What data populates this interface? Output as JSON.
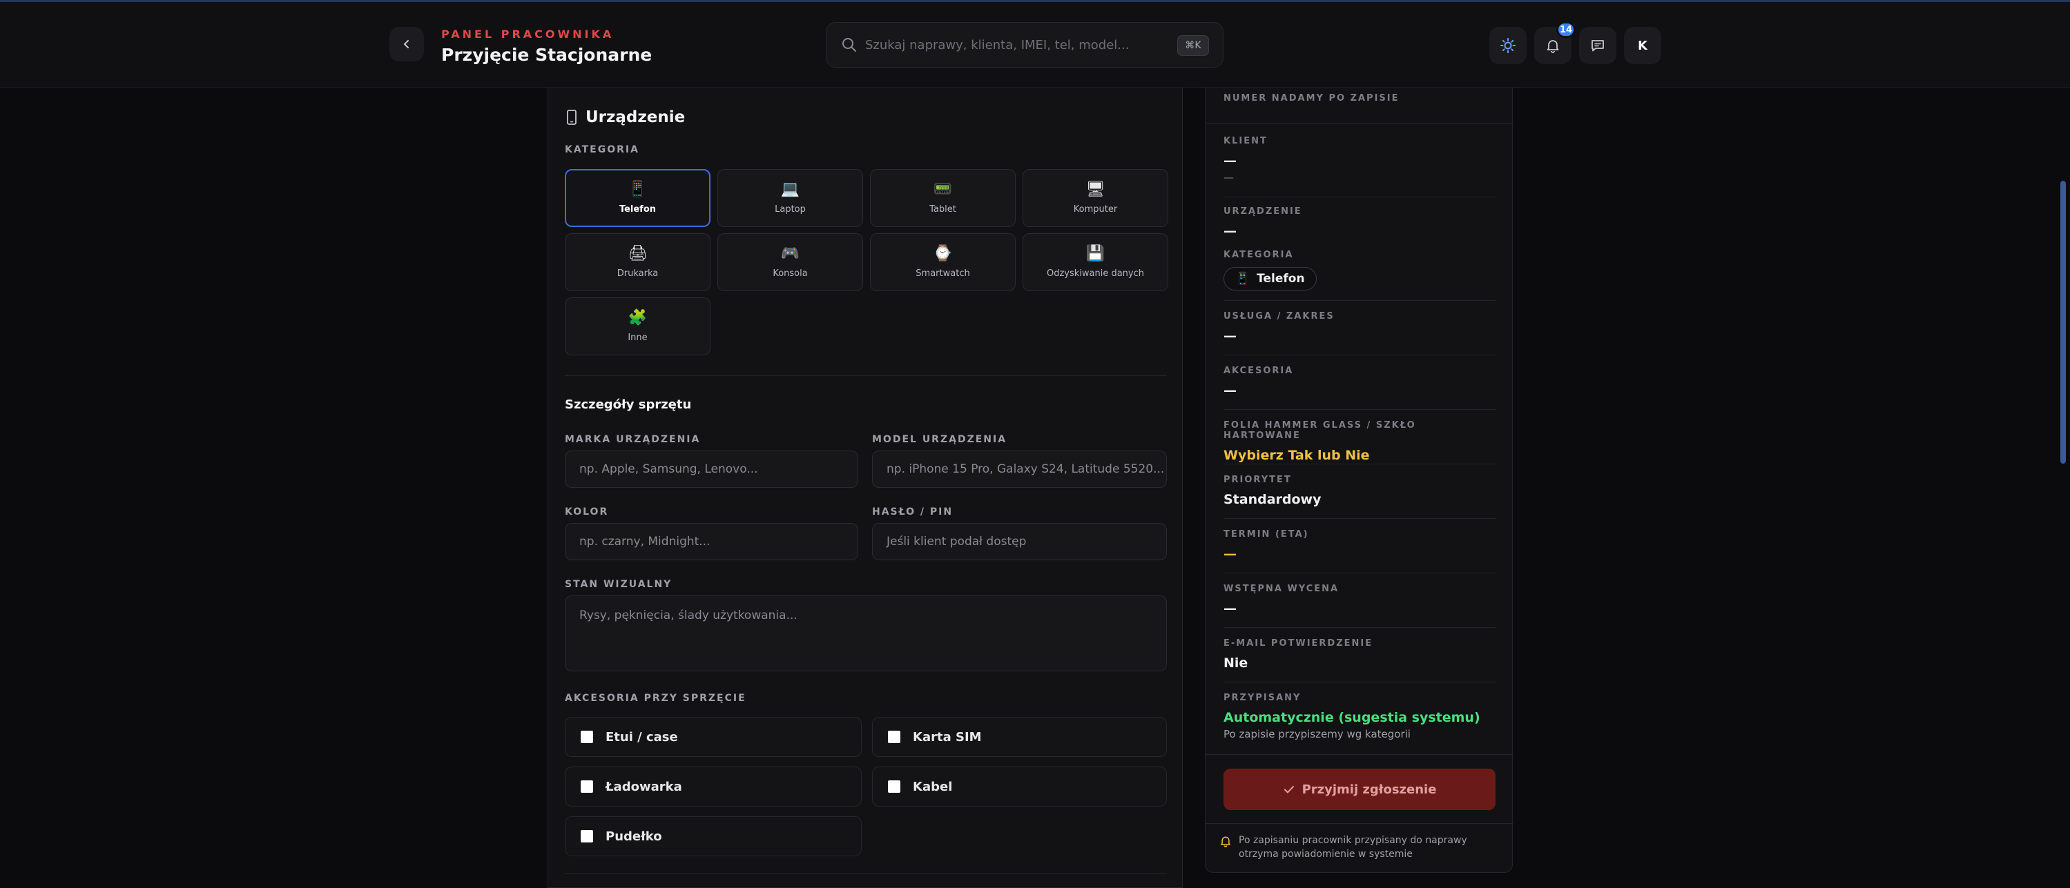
{
  "header": {
    "panel_label": "PANEL PRACOWNIKA",
    "title": "Przyjęcie Stacjonarne",
    "search_placeholder": "Szukaj naprawy, klienta, IMEI, tel, model...",
    "search_shortcut": "⌘K",
    "notifications_count": "14",
    "avatar_initial": "K"
  },
  "device": {
    "title": "Urządzenie",
    "category_label": "KATEGORIA",
    "categories": [
      {
        "label": "Telefon",
        "icon": "📱",
        "selected": true
      },
      {
        "label": "Laptop",
        "icon": "💻",
        "selected": false
      },
      {
        "label": "Tablet",
        "icon": "📟",
        "selected": false
      },
      {
        "label": "Komputer",
        "icon": "🖥",
        "selected": false
      },
      {
        "label": "Drukarka",
        "icon": "🖨",
        "selected": false
      },
      {
        "label": "Konsola",
        "icon": "🎮",
        "selected": false
      },
      {
        "label": "Smartwatch",
        "icon": "⌚",
        "selected": false
      },
      {
        "label": "Odzyskiwanie danych",
        "icon": "💾",
        "selected": false
      },
      {
        "label": "Inne",
        "icon": "🧩",
        "selected": false
      }
    ],
    "details_title": "Szczegóły sprzętu",
    "brand_label": "MARKA URZĄDZENIA",
    "brand_placeholder": "np. Apple, Samsung, Lenovo...",
    "model_label": "MODEL URZĄDZENIA",
    "model_placeholder": "np. iPhone 15 Pro, Galaxy S24, Latitude 5520...",
    "color_label": "KOLOR",
    "color_placeholder": "np. czarny, Midnight...",
    "password_label": "HASŁO / PIN",
    "password_placeholder": "Jeśli klient podał dostęp",
    "visual_label": "STAN WIZUALNY",
    "visual_placeholder": "Rysy, pęknięcia, ślady użytkowania...",
    "accessories_label": "AKCESORIA PRZY SPRZĘCIE",
    "accessories": [
      "Etui / case",
      "Karta SIM",
      "Ładowarka",
      "Kabel",
      "Pudełko"
    ]
  },
  "summary": {
    "number_label": "NUMER NADAMY PO ZAPISIE",
    "client_label": "KLIENT",
    "client_value": "—",
    "client_sub": "—",
    "device_label": "URZĄDZENIE",
    "device_value": "—",
    "category_label": "KATEGORIA",
    "category_value": "Telefon",
    "service_label": "USŁUGA / ZAKRES",
    "service_value": "—",
    "accessories_label": "AKCESORIA",
    "accessories_value": "—",
    "glass_label": "FOLIA HAMMER GLASS / SZKŁO HARTOWANE",
    "glass_value": "Wybierz Tak lub Nie",
    "priority_label": "PRIORYTET",
    "priority_value": "Standardowy",
    "eta_label": "TERMIN (ETA)",
    "eta_value": "—",
    "estimate_label": "WSTĘPNA WYCENA",
    "estimate_value": "—",
    "email_label": "E-MAIL POTWIERDZENIE",
    "email_value": "Nie",
    "assigned_label": "PRZYPISANY",
    "assigned_value": "Automatycznie (sugestia systemu)",
    "assigned_sub": "Po zapisie przypiszemy wg kategorii",
    "submit_label": "Przyjmij zgłoszenie",
    "notice": "Po zapisaniu pracownik przypisany do naprawy otrzyma powiadomienie w systemie"
  },
  "colors": {
    "accent_red": "#e04848",
    "glass_yellow": "#f0c040",
    "assigned_green": "#4ade80",
    "selected_blue": "#3b6fd8"
  }
}
